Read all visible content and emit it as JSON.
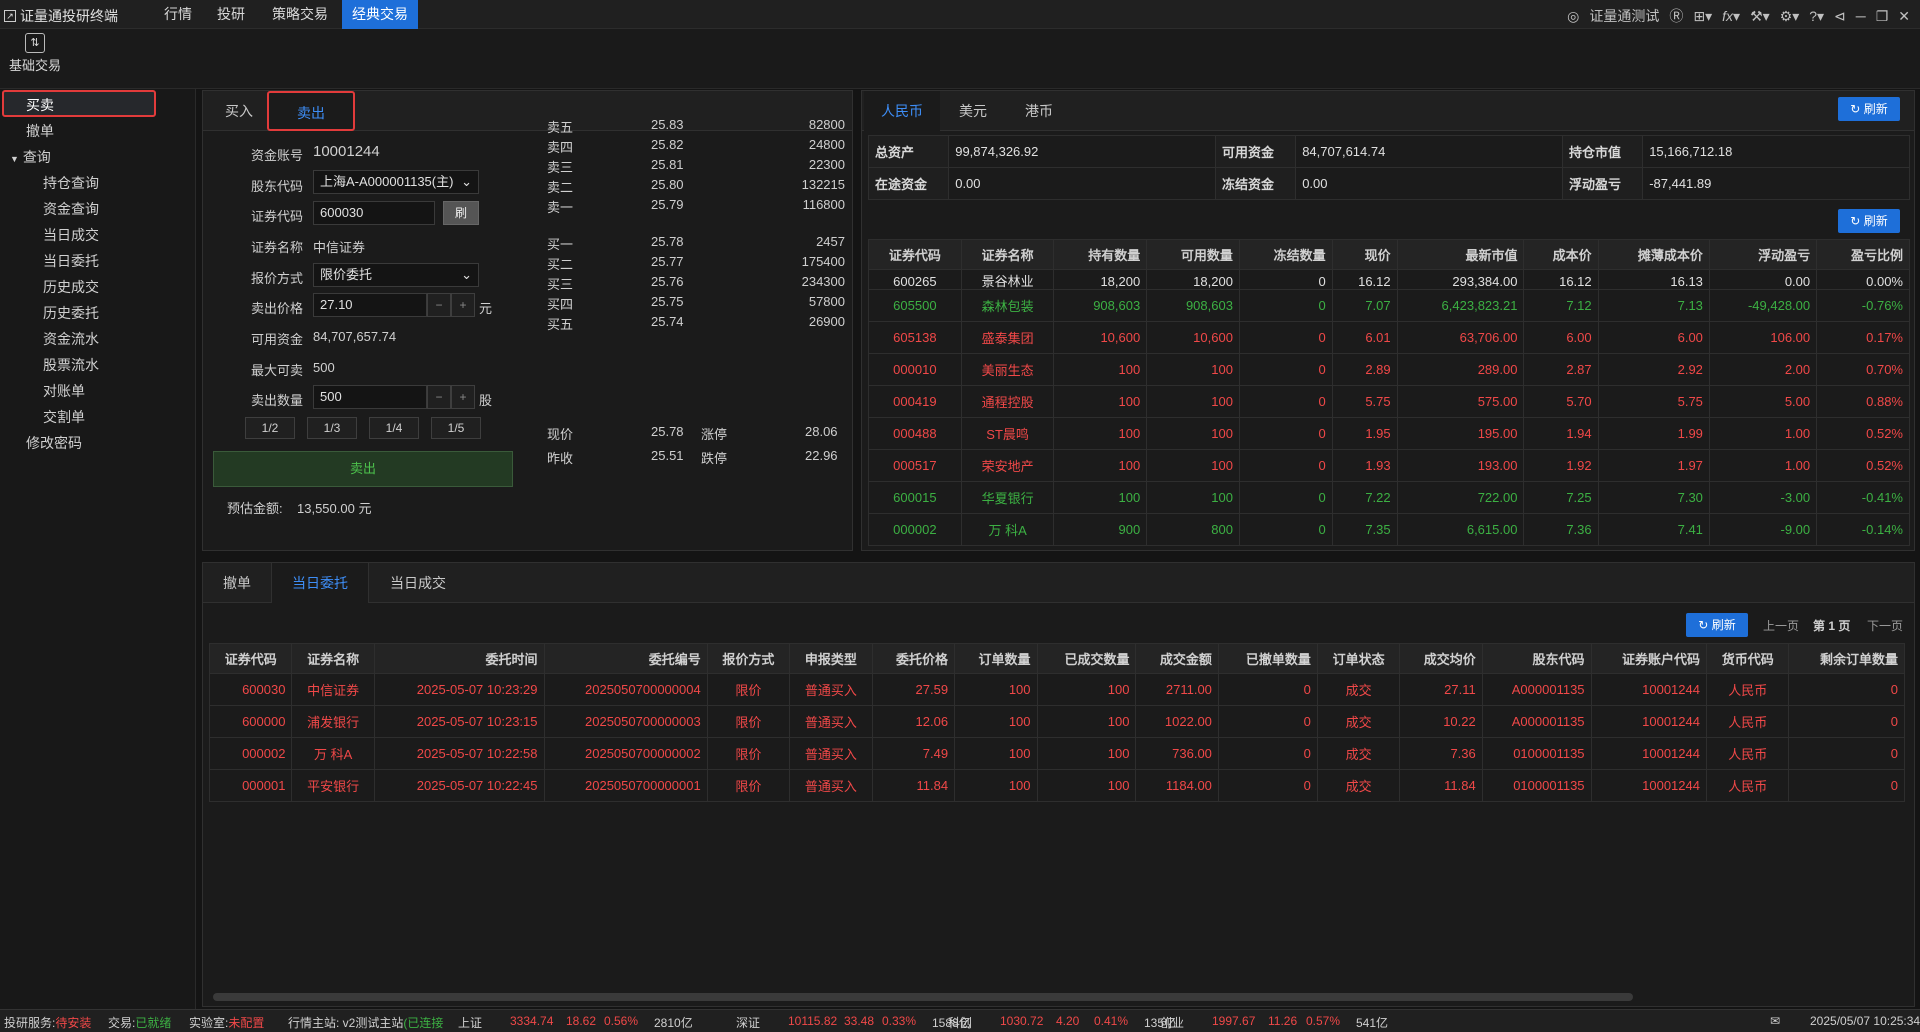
{
  "app": {
    "title": "证量通投研终端"
  },
  "menu": [
    "行情",
    "投研",
    "策略交易",
    "经典交易"
  ],
  "top_right": {
    "user": "证量通测试"
  },
  "toolbar": {
    "basic_trade": "基础交易"
  },
  "sidebar": {
    "items": [
      "买卖",
      "撤单",
      "查询",
      "持仓查询",
      "资金查询",
      "当日成交",
      "当日委托",
      "历史成交",
      "历史委托",
      "资金流水",
      "股票流水",
      "对账单",
      "交割单",
      "修改密码"
    ]
  },
  "order_panel": {
    "tabs": [
      "买入",
      "卖出"
    ],
    "fields": {
      "account_label": "资金账号",
      "account": "10001244",
      "holder_label": "股东代码",
      "holder": "上海A-A000001135(主)",
      "code_label": "证券代码",
      "code": "600030",
      "refresh_btn": "刷",
      "name_label": "证券名称",
      "name": "中信证券",
      "price_type_label": "报价方式",
      "price_type": "限价委托",
      "price_label": "卖出价格",
      "price": "27.10",
      "price_unit": "元",
      "avail_label": "可用资金",
      "avail": "84,707,657.74",
      "max_label": "最大可卖",
      "max": "500",
      "qty_label": "卖出数量",
      "qty": "500",
      "qty_unit": "股",
      "fractions": [
        "1/2",
        "1/3",
        "1/4",
        "1/5"
      ],
      "submit": "卖出",
      "estimate_label": "预估金额:",
      "estimate": "13,550.00 元"
    },
    "quotes": [
      {
        "label": "卖五",
        "price": "25.83",
        "vol": "82800"
      },
      {
        "label": "卖四",
        "price": "25.82",
        "vol": "24800"
      },
      {
        "label": "卖三",
        "price": "25.81",
        "vol": "22300"
      },
      {
        "label": "卖二",
        "price": "25.80",
        "vol": "132215"
      },
      {
        "label": "卖一",
        "price": "25.79",
        "vol": "116800"
      },
      {
        "label": "买一",
        "price": "25.78",
        "vol": "2457"
      },
      {
        "label": "买二",
        "price": "25.77",
        "vol": "175400"
      },
      {
        "label": "买三",
        "price": "25.76",
        "vol": "234300"
      },
      {
        "label": "买四",
        "price": "25.75",
        "vol": "57800"
      },
      {
        "label": "买五",
        "price": "25.74",
        "vol": "26900"
      }
    ],
    "summary": {
      "now_label": "现价",
      "now": "25.78",
      "up_label": "涨停",
      "up": "28.06",
      "prev_label": "昨收",
      "prev": "25.51",
      "down_label": "跌停",
      "down": "22.96"
    }
  },
  "account_panel": {
    "tabs": [
      "人民币",
      "美元",
      "港币"
    ],
    "refresh": "刷新",
    "rows": [
      [
        {
          "k": "总资产",
          "v": "99,874,326.92"
        },
        {
          "k": "可用资金",
          "v": "84,707,614.74"
        },
        {
          "k": "持仓市值",
          "v": "15,166,712.18"
        }
      ],
      [
        {
          "k": "在途资金",
          "v": "0.00"
        },
        {
          "k": "冻结资金",
          "v": "0.00"
        },
        {
          "k": "浮动盈亏",
          "v": "-87,441.89"
        }
      ]
    ]
  },
  "positions": {
    "refresh": "刷新",
    "headers": [
      "证券代码",
      "证券名称",
      "持有数量",
      "可用数量",
      "冻结数量",
      "现价",
      "最新市值",
      "成本价",
      "摊薄成本价",
      "浮动盈亏",
      "盈亏比例"
    ],
    "rows": [
      {
        "c": "white",
        "v": [
          "600265",
          "景谷林业",
          "18,200",
          "18,200",
          "0",
          "16.12",
          "293,384.00",
          "16.12",
          "16.13",
          "0.00",
          "0.00%"
        ]
      },
      {
        "c": "green",
        "v": [
          "605500",
          "森林包装",
          "908,603",
          "908,603",
          "0",
          "7.07",
          "6,423,823.21",
          "7.12",
          "7.13",
          "-49,428.00",
          "-0.76%"
        ]
      },
      {
        "c": "red",
        "v": [
          "605138",
          "盛泰集团",
          "10,600",
          "10,600",
          "0",
          "6.01",
          "63,706.00",
          "6.00",
          "6.00",
          "106.00",
          "0.17%"
        ]
      },
      {
        "c": "red",
        "v": [
          "000010",
          "美丽生态",
          "100",
          "100",
          "0",
          "2.89",
          "289.00",
          "2.87",
          "2.92",
          "2.00",
          "0.70%"
        ]
      },
      {
        "c": "red",
        "v": [
          "000419",
          "通程控股",
          "100",
          "100",
          "0",
          "5.75",
          "575.00",
          "5.70",
          "5.75",
          "5.00",
          "0.88%"
        ]
      },
      {
        "c": "red",
        "v": [
          "000488",
          "ST晨鸣",
          "100",
          "100",
          "0",
          "1.95",
          "195.00",
          "1.94",
          "1.99",
          "1.00",
          "0.52%"
        ]
      },
      {
        "c": "red",
        "v": [
          "000517",
          "荣安地产",
          "100",
          "100",
          "0",
          "1.93",
          "193.00",
          "1.92",
          "1.97",
          "1.00",
          "0.52%"
        ]
      },
      {
        "c": "green",
        "v": [
          "600015",
          "华夏银行",
          "100",
          "100",
          "0",
          "7.22",
          "722.00",
          "7.25",
          "7.30",
          "-3.00",
          "-0.41%"
        ]
      },
      {
        "c": "green",
        "v": [
          "000002",
          "万 科A",
          "900",
          "800",
          "0",
          "7.35",
          "6,615.00",
          "7.36",
          "7.41",
          "-9.00",
          "-0.14%"
        ]
      }
    ]
  },
  "orders_panel": {
    "tabs": [
      "撤单",
      "当日委托",
      "当日成交"
    ],
    "refresh": "刷新",
    "prev": "上一页",
    "page": "第 1 页",
    "next": "下一页",
    "headers": [
      "证券代码",
      "证券名称",
      "委托时间",
      "委托编号",
      "报价方式",
      "申报类型",
      "委托价格",
      "订单数量",
      "已成交数量",
      "成交金额",
      "已撤单数量",
      "订单状态",
      "成交均价",
      "股东代码",
      "证券账户代码",
      "货币代码",
      "剩余订单数量"
    ],
    "rows": [
      [
        "600030",
        "中信证券",
        "2025-05-07 10:23:29",
        "2025050700000004",
        "限价",
        "普通买入",
        "27.59",
        "100",
        "100",
        "2711.00",
        "0",
        "成交",
        "27.11",
        "A000001135",
        "10001244",
        "人民币",
        "0"
      ],
      [
        "600000",
        "浦发银行",
        "2025-05-07 10:23:15",
        "2025050700000003",
        "限价",
        "普通买入",
        "12.06",
        "100",
        "100",
        "1022.00",
        "0",
        "成交",
        "10.22",
        "A000001135",
        "10001244",
        "人民币",
        "0"
      ],
      [
        "000002",
        "万 科A",
        "2025-05-07 10:22:58",
        "2025050700000002",
        "限价",
        "普通买入",
        "7.49",
        "100",
        "100",
        "736.00",
        "0",
        "成交",
        "7.36",
        "0100001135",
        "10001244",
        "人民币",
        "0"
      ],
      [
        "000001",
        "平安银行",
        "2025-05-07 10:22:45",
        "2025050700000001",
        "限价",
        "普通买入",
        "11.84",
        "100",
        "100",
        "1184.00",
        "0",
        "成交",
        "11.84",
        "0100001135",
        "10001244",
        "人民币",
        "0"
      ]
    ]
  },
  "statusbar": {
    "research_label": "投研服务:",
    "research": "待安装",
    "trade_label": "交易:",
    "trade": "已就绪",
    "lab_label": "实验室:",
    "lab": "未配置",
    "quote_label": "行情主站: v2测试主站",
    "quote": "(已连接",
    "indices": [
      {
        "name": "上证",
        "v": "3334.74",
        "c": "18.62",
        "p": "0.56%",
        "a": "2810亿"
      },
      {
        "name": "深证",
        "v": "10115.82",
        "c": "33.48",
        "p": "0.33%",
        "a": "1588亿"
      },
      {
        "name": "科创",
        "v": "1030.72",
        "c": "4.20",
        "p": "0.41%",
        "a": "135亿"
      },
      {
        "name": "创业",
        "v": "1997.67",
        "c": "11.26",
        "p": "0.57%",
        "a": "541亿"
      }
    ],
    "datetime": "2025/05/07 10:25:34"
  }
}
